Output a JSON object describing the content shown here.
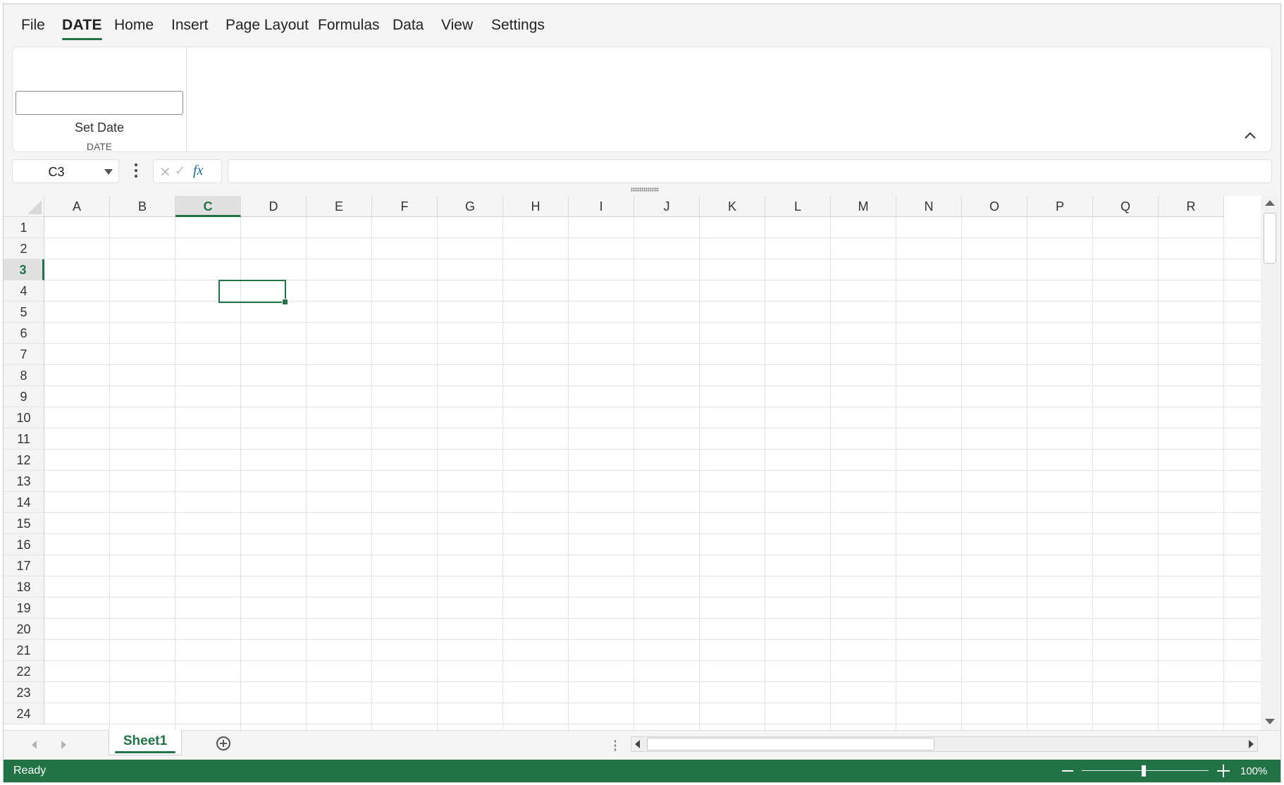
{
  "menu": {
    "items": [
      {
        "label": "File",
        "active": false
      },
      {
        "label": "DATE",
        "active": true
      },
      {
        "label": "Home",
        "active": false
      },
      {
        "label": "Insert",
        "active": false
      },
      {
        "label": "Page Layout",
        "active": false
      },
      {
        "label": "Formulas",
        "active": false
      },
      {
        "label": "Data",
        "active": false
      },
      {
        "label": "View",
        "active": false
      },
      {
        "label": "Settings",
        "active": false
      }
    ]
  },
  "ribbon": {
    "date_input_value": "",
    "set_date_label": "Set Date",
    "group_label": "DATE",
    "collapse_icon": "chevron-up-icon"
  },
  "formula_bar": {
    "name_box": "C3",
    "formula_value": "",
    "cancel_glyph": "✕",
    "enter_glyph": "✓",
    "fx_label": "fx"
  },
  "grid": {
    "columns": [
      "A",
      "B",
      "C",
      "D",
      "E",
      "F",
      "G",
      "H",
      "I",
      "J",
      "K",
      "L",
      "M",
      "N",
      "O",
      "P",
      "Q",
      "R"
    ],
    "rows": [
      "1",
      "2",
      "3",
      "4",
      "5",
      "6",
      "7",
      "8",
      "9",
      "10",
      "11",
      "12",
      "13",
      "14",
      "15",
      "16",
      "17",
      "18",
      "19",
      "20",
      "21",
      "22",
      "23",
      "24"
    ],
    "selected_column": "C",
    "selected_row": "3"
  },
  "sheets": {
    "tabs": [
      "Sheet1"
    ],
    "active": "Sheet1"
  },
  "status": {
    "text": "Ready",
    "zoom": "100%"
  },
  "colors": {
    "accent": "#217346",
    "fx": "#1d6b97"
  }
}
